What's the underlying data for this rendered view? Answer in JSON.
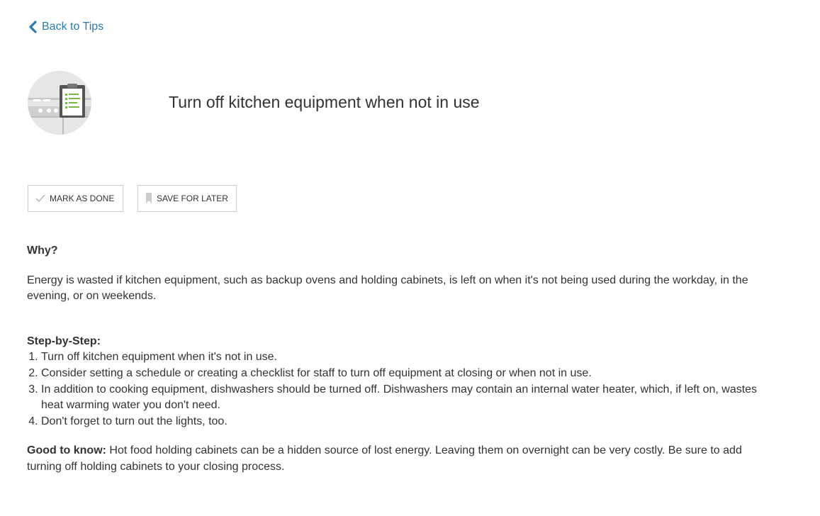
{
  "nav": {
    "back_label": "Back to Tips",
    "back_icon": "chevron-left-icon"
  },
  "tip": {
    "title": "Turn off kitchen equipment when not in use",
    "icon": "clipboard-checklist-icon"
  },
  "actions": {
    "mark_done_label": "MARK AS DONE",
    "mark_done_icon": "checkmark-icon",
    "save_label": "SAVE FOR LATER",
    "save_icon": "bookmark-icon"
  },
  "why": {
    "heading": "Why?",
    "text": "Energy is wasted if kitchen equipment, such as backup ovens and holding cabinets, is left on when it's not being used during the workday, in the evening, or on weekends."
  },
  "steps": {
    "heading": "Step-by-Step:",
    "items": [
      "Turn off kitchen equipment when it's not in use.",
      "Consider setting a schedule or creating a checklist for staff to turn off equipment at closing or when not in use.",
      "In addition to cooking equipment, dishwashers should be turned off. Dishwashers may contain an internal water heater, which, if left on, wastes heat warming water you don't need.",
      "Don't forget to turn out the lights, too."
    ]
  },
  "good_to_know": {
    "label": "Good to know:",
    "text": " Hot food holding cabinets can be a hidden source of lost energy. Leaving them on overnight can be very costly. Be sure to add turning off holding cabinets to your closing process."
  },
  "colors": {
    "link": "#2a7ab0",
    "text": "#333333",
    "border": "#cccccc",
    "icon_bg": "#e6e6e6",
    "checklist_green": "#7ab648"
  }
}
